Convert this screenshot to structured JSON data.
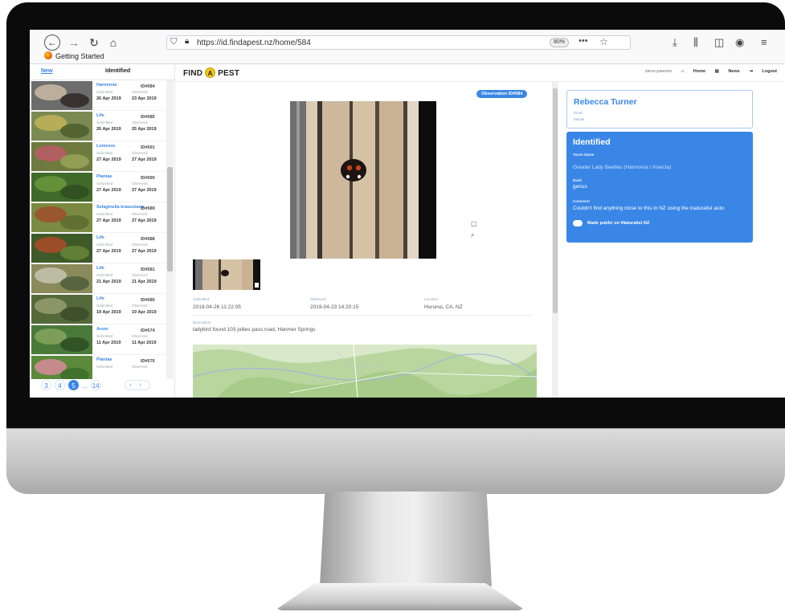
{
  "browser": {
    "url": "https://id.findapest.nz/home/584",
    "zoom": "80%",
    "bookmark": "Getting Started",
    "icons": [
      "back-icon",
      "forward-icon",
      "reload-icon",
      "home-icon",
      "shield-icon",
      "lock-icon",
      "page-actions-icon",
      "bookmark-star-icon",
      "download-icon",
      "library-icon",
      "sidebar-icon",
      "account-icon",
      "menu-icon"
    ]
  },
  "app": {
    "logo_left": "FIND",
    "logo_mid": "A",
    "logo_right": "PEST",
    "nav": {
      "user": "steve.pawson",
      "home": "Home",
      "news": "News",
      "logout": "Logout"
    }
  },
  "sidebar": {
    "tabs": {
      "new": "New",
      "identified": "Identified"
    },
    "submitted_label": "Submitted",
    "observed_label": "Observed",
    "items": [
      {
        "name": "Harmonia",
        "id": "ID#584",
        "submitted": "26 Apr 2019",
        "observed": "23 Apr 2019"
      },
      {
        "name": "Life",
        "id": "ID#585",
        "submitted": "26 Apr 2019",
        "observed": "25 Apr 2019"
      },
      {
        "name": "Lonicera",
        "id": "ID#591",
        "submitted": "27 Apr 2019",
        "observed": "27 Apr 2019"
      },
      {
        "name": "Plantae",
        "id": "ID#590",
        "submitted": "27 Apr 2019",
        "observed": "27 Apr 2019"
      },
      {
        "name": "Selaginella kraussiana",
        "id": "ID#589",
        "submitted": "27 Apr 2019",
        "observed": "27 Apr 2019"
      },
      {
        "name": "Life",
        "id": "ID#588",
        "submitted": "27 Apr 2019",
        "observed": "27 Apr 2019"
      },
      {
        "name": "Life",
        "id": "ID#581",
        "submitted": "21 Apr 2019",
        "observed": "21 Apr 2019"
      },
      {
        "name": "Life",
        "id": "ID#580",
        "submitted": "19 Apr 2019",
        "observed": "19 Apr 2019"
      },
      {
        "name": "Arum",
        "id": "ID#574",
        "submitted": "11 Apr 2019",
        "observed": "11 Apr 2019"
      },
      {
        "name": "Plantae",
        "id": "ID#576",
        "submitted": "",
        "observed": ""
      }
    ],
    "pager": {
      "pages": [
        "3",
        "4",
        "5",
        "...",
        "14"
      ],
      "current": "5",
      "prev": "‹",
      "next": "›"
    }
  },
  "observation": {
    "badge": "Observation ID#584",
    "submitted_label": "Submitted",
    "submitted": "2019-04-26 11:22:05",
    "observed_label": "Observed",
    "observed": "2019-04-23 14:20:15",
    "location_label": "Location",
    "location": "Hurunui, CA, NZ",
    "description_label": "Description",
    "description": "ladybird found 103 jollies pass road, Hanmer Springs"
  },
  "user": {
    "name": "Rebecca Turner",
    "email_label": "Email",
    "mobile_label": "Mobile"
  },
  "identified": {
    "title": "Identified",
    "taxon_label": "Taxon Name",
    "taxon": "Greater Lady Beetles (Harmonia / Insecta)",
    "rank_label": "Rank",
    "rank": "genus",
    "comment_label": "Comment",
    "comment": "Couldn't find anything close to this in NZ using the inaturalist auto",
    "public_label": "Made public on iNaturalist NZ"
  },
  "colors": {
    "accent": "#3a86e6",
    "logo_yellow": "#f5c518"
  }
}
